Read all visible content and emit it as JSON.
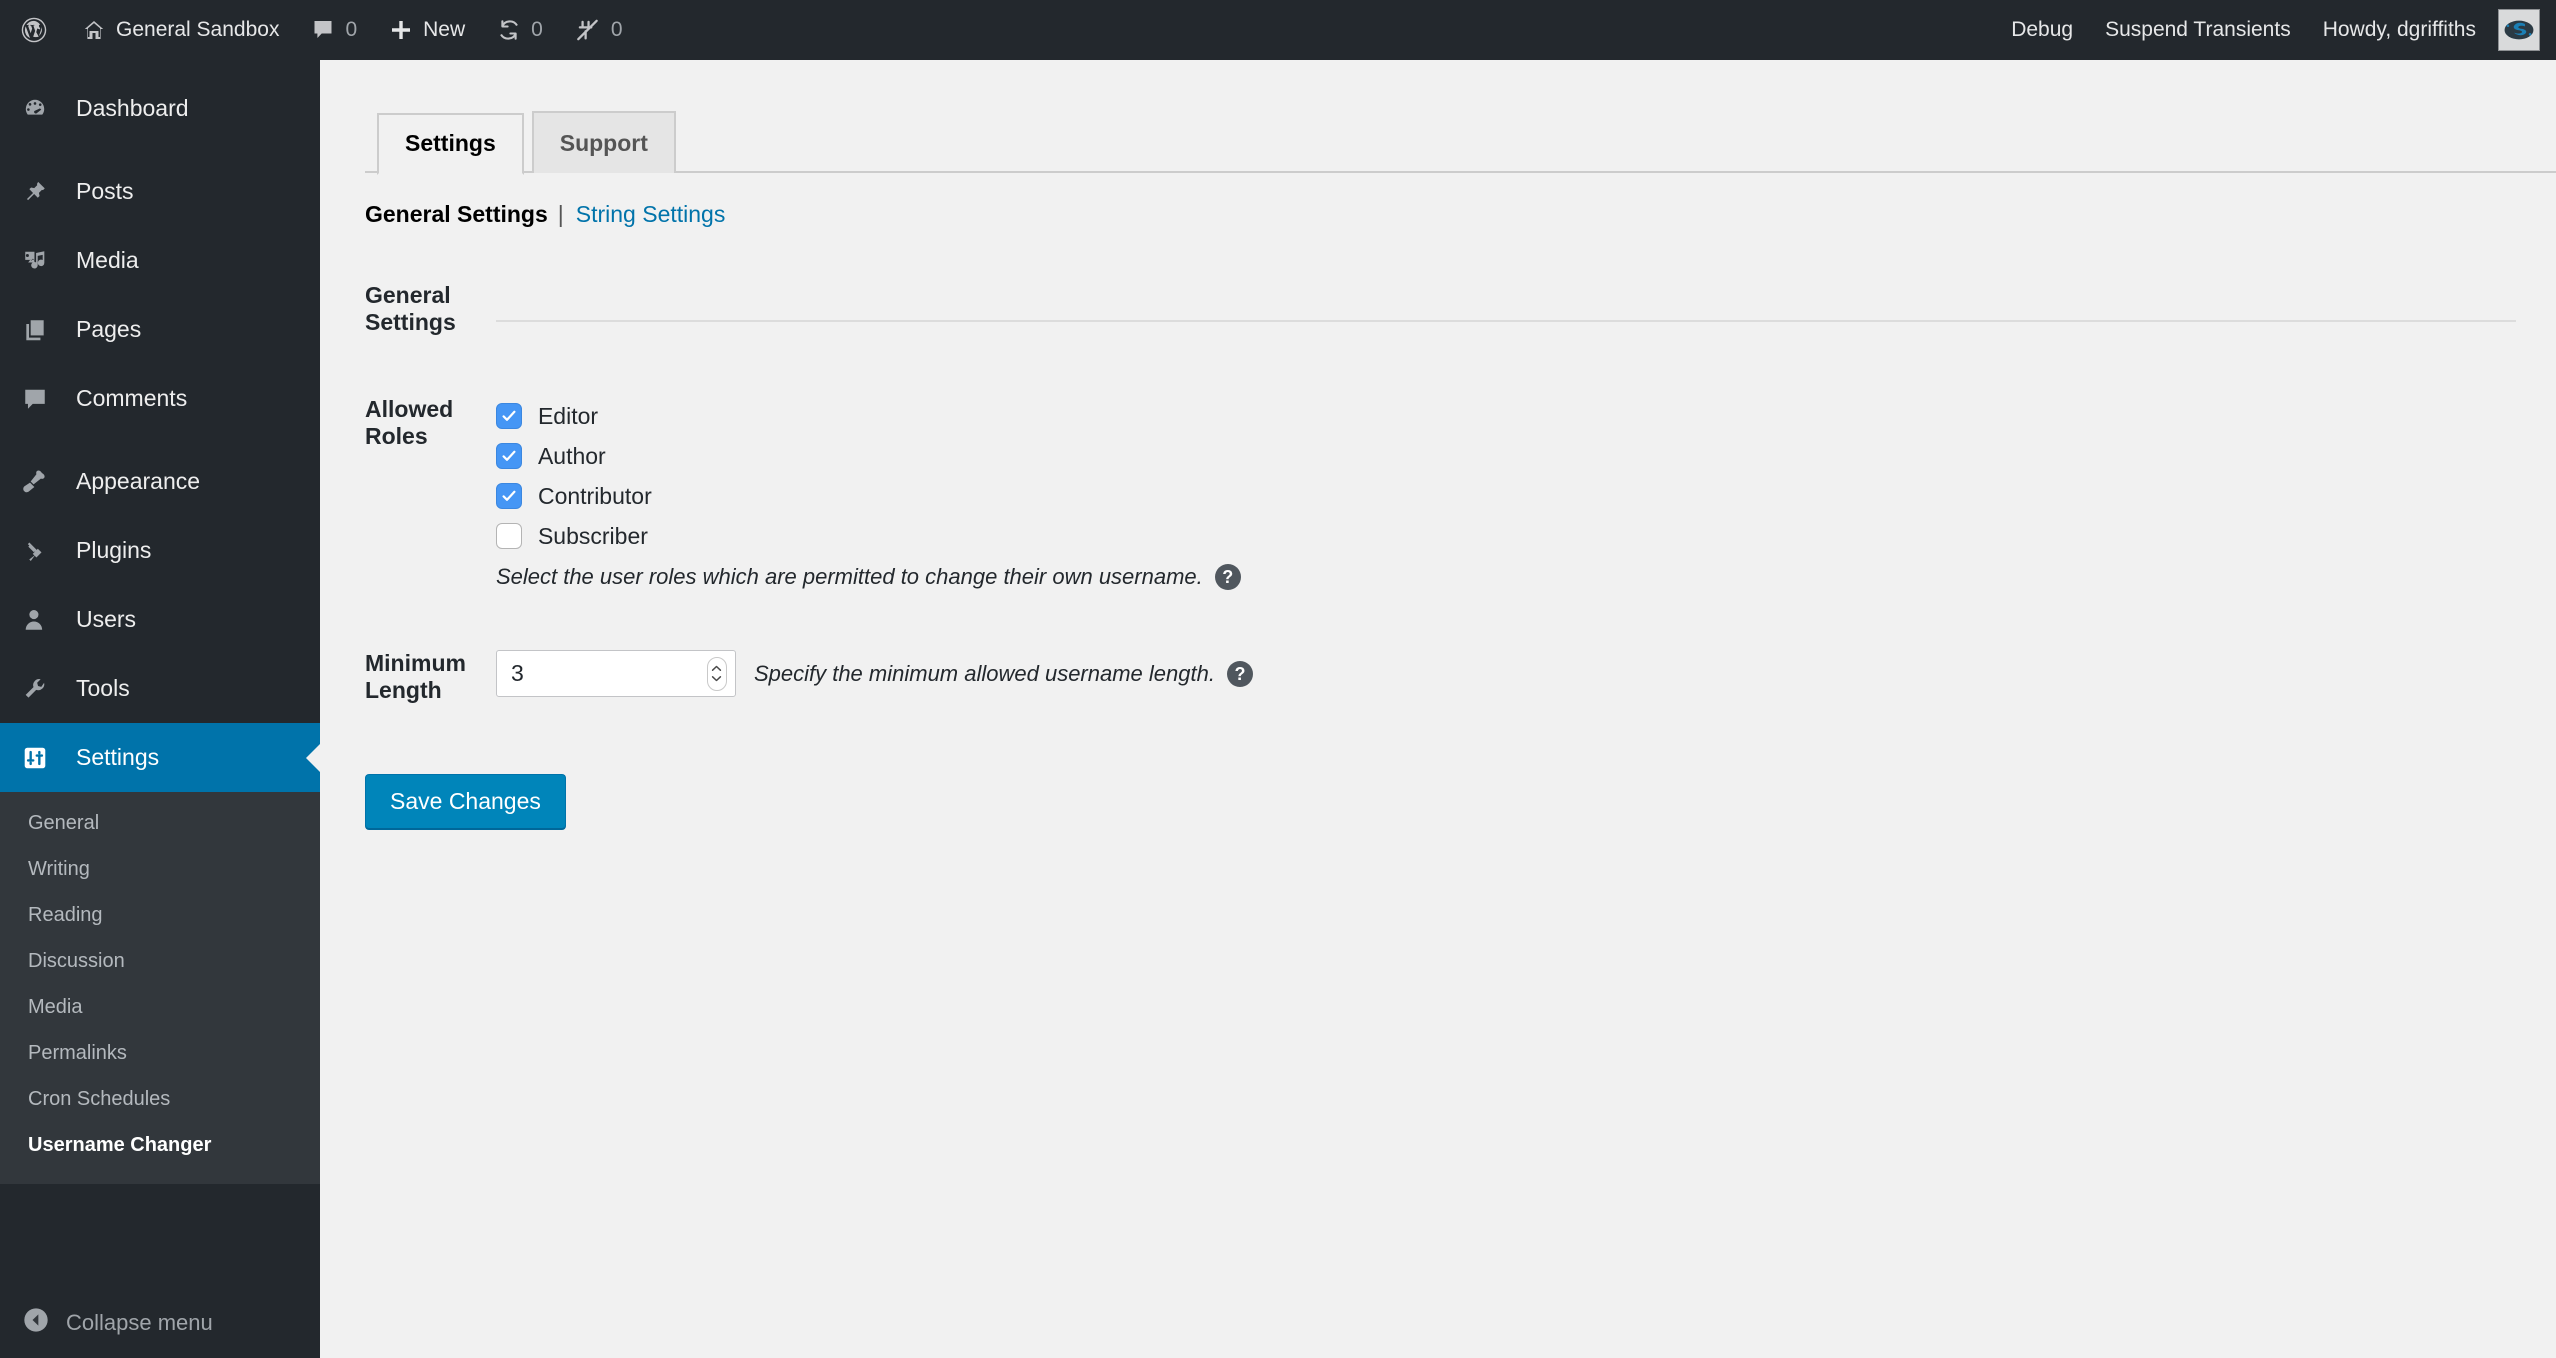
{
  "adminbar": {
    "left": [
      {
        "icon": "wordpress-logo-icon",
        "label": "",
        "count": ""
      },
      {
        "icon": "home-icon",
        "label": "General Sandbox",
        "count": ""
      },
      {
        "icon": "comment-bubble-icon",
        "label": "",
        "count": "0"
      },
      {
        "icon": "plus-icon",
        "label": "New",
        "count": ""
      },
      {
        "icon": "update-refresh-icon",
        "label": "",
        "count": "0"
      },
      {
        "icon": "plugin-disabled-icon",
        "label": "",
        "count": "0"
      }
    ],
    "right": [
      {
        "label": "Debug"
      },
      {
        "label": "Suspend Transients"
      },
      {
        "label": "Howdy, dgriffiths"
      }
    ],
    "avatar_alt": "avatar"
  },
  "sidebar": {
    "items": [
      {
        "label": "Dashboard",
        "icon": "dashboard-icon",
        "current": false,
        "gap_after": true
      },
      {
        "label": "Posts",
        "icon": "pin-icon",
        "current": false,
        "gap_after": false
      },
      {
        "label": "Media",
        "icon": "media-icon",
        "current": false,
        "gap_after": false
      },
      {
        "label": "Pages",
        "icon": "pages-icon",
        "current": false,
        "gap_after": false
      },
      {
        "label": "Comments",
        "icon": "comment-bubble-icon",
        "current": false,
        "gap_after": true
      },
      {
        "label": "Appearance",
        "icon": "paintbrush-icon",
        "current": false,
        "gap_after": false
      },
      {
        "label": "Plugins",
        "icon": "plug-icon",
        "current": false,
        "gap_after": false
      },
      {
        "label": "Users",
        "icon": "user-icon",
        "current": false,
        "gap_after": false
      },
      {
        "label": "Tools",
        "icon": "wrench-icon",
        "current": false,
        "gap_after": false
      },
      {
        "label": "Settings",
        "icon": "settings-sliders-icon",
        "current": true,
        "gap_after": false
      }
    ],
    "submenu": [
      {
        "label": "General",
        "current": false
      },
      {
        "label": "Writing",
        "current": false
      },
      {
        "label": "Reading",
        "current": false
      },
      {
        "label": "Discussion",
        "current": false
      },
      {
        "label": "Media",
        "current": false
      },
      {
        "label": "Permalinks",
        "current": false
      },
      {
        "label": "Cron Schedules",
        "current": false
      },
      {
        "label": "Username Changer",
        "current": true
      }
    ],
    "collapse": {
      "label": "Collapse menu",
      "icon": "collapse-arrow-icon"
    }
  },
  "main": {
    "tabs": [
      {
        "label": "Settings",
        "active": true
      },
      {
        "label": "Support",
        "active": false
      }
    ],
    "subnav": {
      "current": "General Settings",
      "separator": "|",
      "link": "String Settings"
    },
    "section_title": "General Settings",
    "fields": {
      "allowed_roles": {
        "label": "Allowed Roles",
        "options": [
          {
            "label": "Editor",
            "checked": true
          },
          {
            "label": "Author",
            "checked": true
          },
          {
            "label": "Contributor",
            "checked": true
          },
          {
            "label": "Subscriber",
            "checked": false
          }
        ],
        "description": "Select the user roles which are permitted to change their own username.",
        "help_glyph": "?"
      },
      "minimum_length": {
        "label": "Minimum Length",
        "value": "3",
        "description": "Specify the minimum allowed username length.",
        "help_glyph": "?"
      }
    },
    "submit_label": "Save Changes"
  },
  "colors": {
    "admin_bar_bg": "#23282d",
    "sidebar_bg": "#23282d",
    "submenu_bg": "#32373c",
    "accent_blue": "#0073aa",
    "button_blue": "#0085ba",
    "link_blue": "#0073aa",
    "checkbox_blue": "#4596f5",
    "content_bg": "#f1f1f1"
  }
}
